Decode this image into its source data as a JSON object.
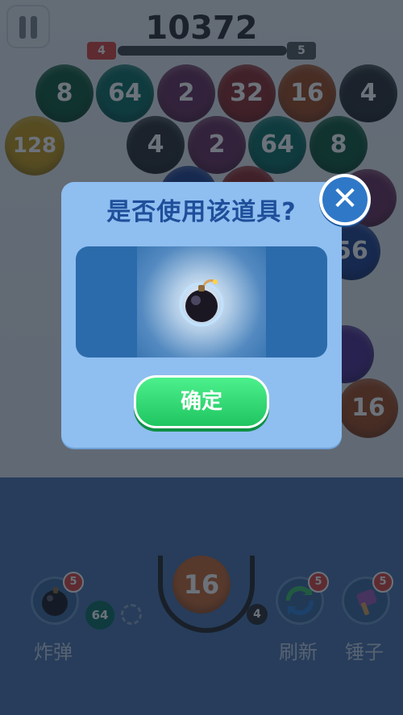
{
  "hud": {
    "score": "10372",
    "level_current": "4",
    "level_next": "5",
    "progress_pct": 0
  },
  "board_balls_row1": [
    "8",
    "64",
    "2",
    "32",
    "16",
    "4"
  ],
  "board_balls_row2": [
    "128",
    "4",
    "2",
    "64",
    "8"
  ],
  "board_partial": [
    "56",
    "16"
  ],
  "dialog": {
    "title": "是否使用该道具?",
    "confirm_label": "确定"
  },
  "tools": {
    "bomb": {
      "label": "炸弹",
      "count": "5"
    },
    "refresh": {
      "label": "刷新",
      "count": "5"
    },
    "hammer": {
      "label": "锤子",
      "count": "5"
    }
  },
  "shooter": {
    "current": "16",
    "next": "64",
    "remaining": "4"
  },
  "colors": {
    "ball_8": "#0f5a3a",
    "ball_64": "#0c6f63",
    "ball_2": "#6a2f59",
    "ball_32": "#8f2a2a",
    "ball_16": "#9f4a1f",
    "ball_4": "#2a2f34",
    "ball_128": "#c49a16"
  }
}
